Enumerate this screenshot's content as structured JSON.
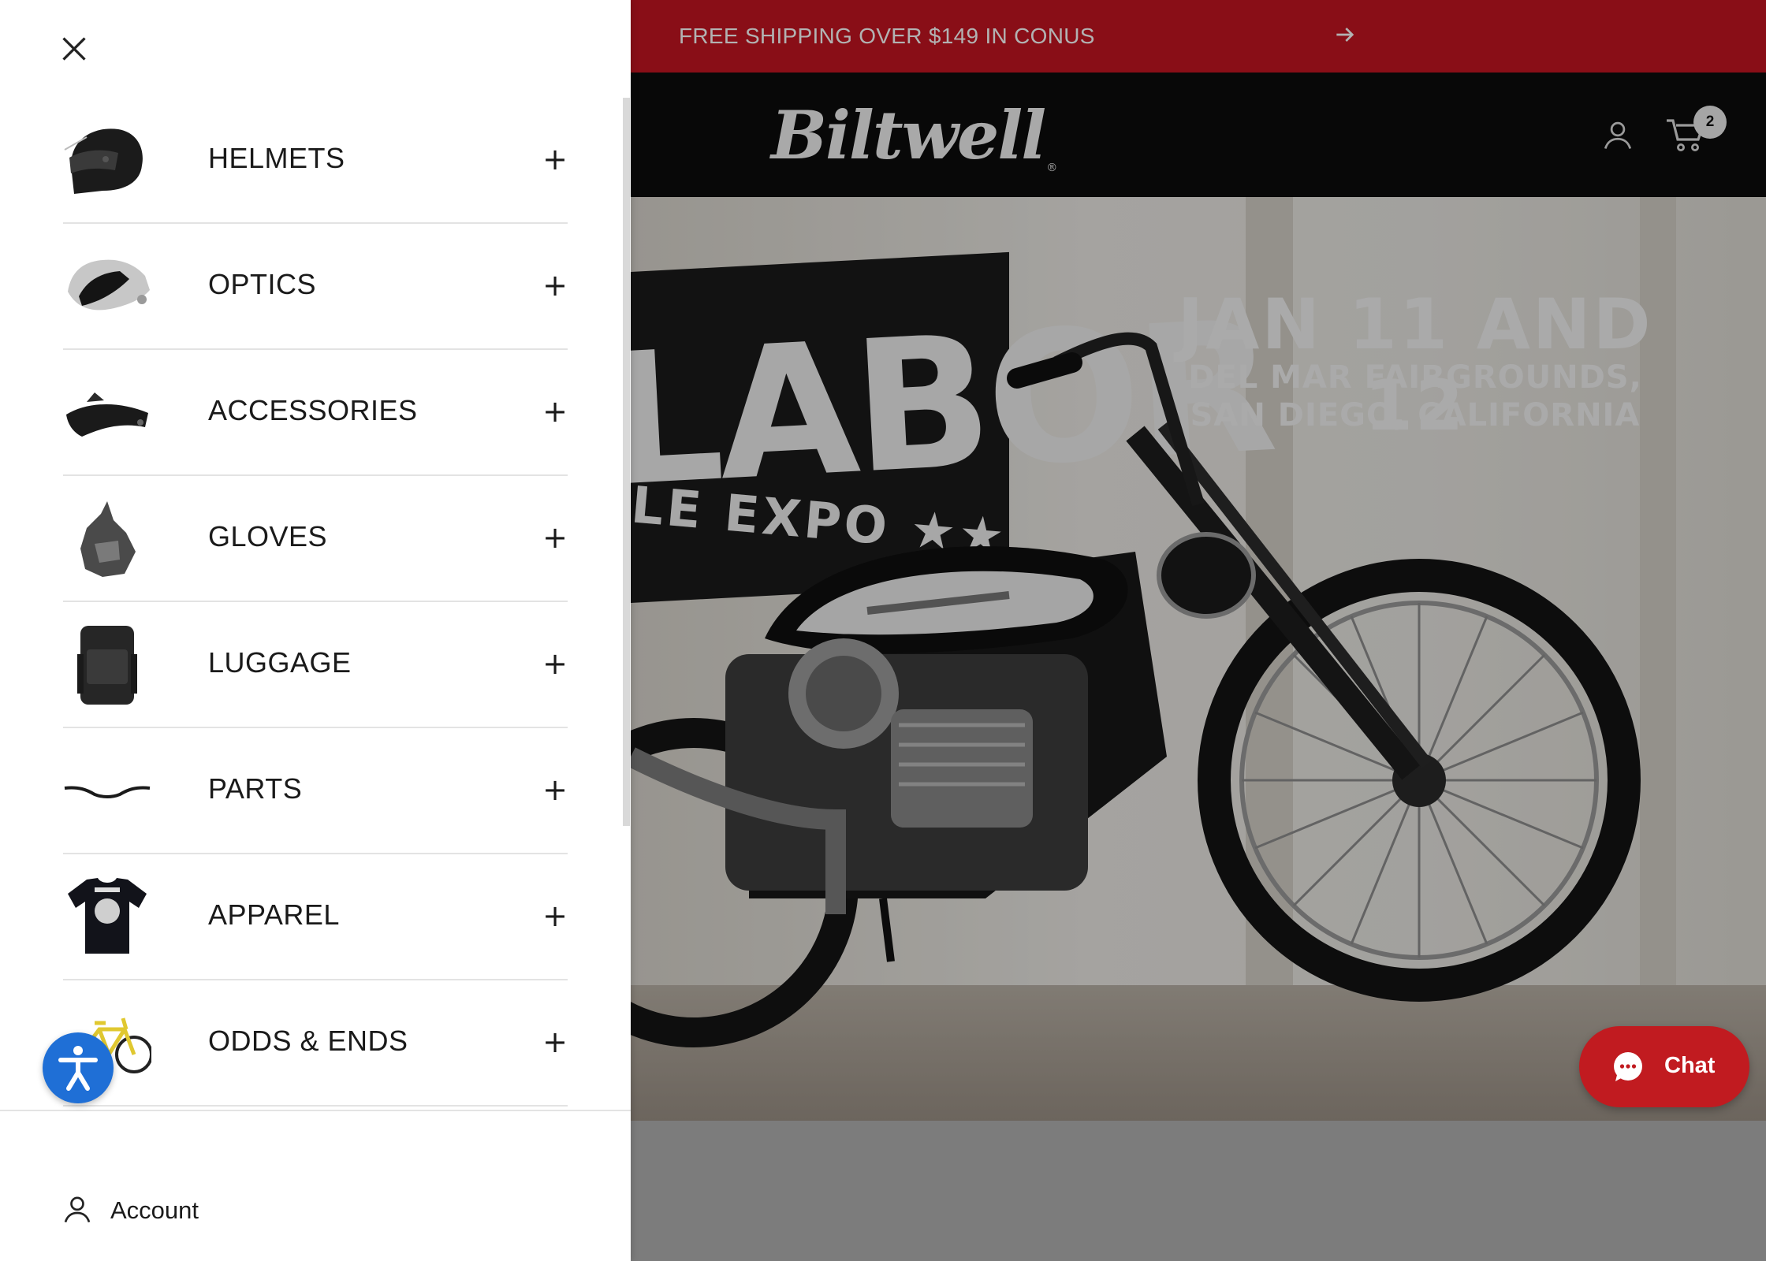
{
  "announcement": {
    "text": "FREE SHIPPING OVER $149 IN CONUS",
    "arrow_icon": "arrow-right-icon",
    "background_color": "#c41521"
  },
  "header": {
    "logo_text": "Biltwell",
    "logo_mark": "®",
    "account_icon": "user-icon",
    "cart_icon": "cart-icon",
    "cart_count": "2"
  },
  "hero": {
    "banner_text": "LABOR",
    "banner_subtext": "LE EXPO ★★",
    "event_date": "JAN 11 AND 12",
    "event_place_line1": "DEL MAR FAIRGROUNDS,",
    "event_place_line2": "SAN DIEGO, CALIFORNIA"
  },
  "chat": {
    "label": "Chat",
    "icon": "chat-bubble-icon",
    "color": "#c11b20"
  },
  "drawer": {
    "close_icon": "close-icon",
    "items": [
      {
        "label": "HELMETS",
        "expand": "+",
        "thumb": "helmet"
      },
      {
        "label": "OPTICS",
        "expand": "+",
        "thumb": "visor"
      },
      {
        "label": "ACCESSORIES",
        "expand": "+",
        "thumb": "peak"
      },
      {
        "label": "GLOVES",
        "expand": "+",
        "thumb": "glove"
      },
      {
        "label": "LUGGAGE",
        "expand": "+",
        "thumb": "backpack"
      },
      {
        "label": "PARTS",
        "expand": "+",
        "thumb": "handlebar"
      },
      {
        "label": "APPAREL",
        "expand": "+",
        "thumb": "tshirt"
      },
      {
        "label": "ODDS & ENDS",
        "expand": "+",
        "thumb": "bicycle"
      }
    ],
    "account_label": "Account",
    "account_icon": "user-icon"
  },
  "accessibility": {
    "icon": "accessibility-icon",
    "color": "#1f6fd6"
  }
}
